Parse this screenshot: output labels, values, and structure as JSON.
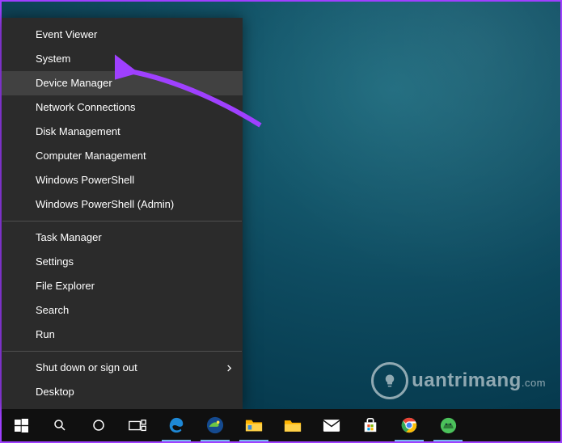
{
  "menu": {
    "items": [
      {
        "label": "Event Viewer"
      },
      {
        "label": "System"
      },
      {
        "label": "Device Manager",
        "highlight": true
      },
      {
        "label": "Network Connections"
      },
      {
        "label": "Disk Management"
      },
      {
        "label": "Computer Management"
      },
      {
        "label": "Windows PowerShell"
      },
      {
        "label": "Windows PowerShell (Admin)"
      }
    ],
    "items2": [
      {
        "label": "Task Manager"
      },
      {
        "label": "Settings"
      },
      {
        "label": "File Explorer"
      },
      {
        "label": "Search"
      },
      {
        "label": "Run"
      }
    ],
    "items3": [
      {
        "label": "Shut down or sign out",
        "submenu": true
      },
      {
        "label": "Desktop"
      }
    ]
  },
  "watermark": {
    "text": "uantrimang",
    "suffix": ".com"
  },
  "taskbar": {
    "start": "start-menu",
    "items": [
      {
        "name": "search-icon"
      },
      {
        "name": "cortana-icon"
      },
      {
        "name": "task-view-icon"
      },
      {
        "name": "edge-icon",
        "open": true
      },
      {
        "name": "dev-icon",
        "open": true
      },
      {
        "name": "folder-icon",
        "open": true
      },
      {
        "name": "file-explorer-icon"
      },
      {
        "name": "mail-icon"
      },
      {
        "name": "store-icon"
      },
      {
        "name": "chrome-icon",
        "open": true
      },
      {
        "name": "app-icon",
        "open": true
      }
    ]
  },
  "annotation": {
    "target": "Device Manager",
    "color": "#9f40ff"
  }
}
